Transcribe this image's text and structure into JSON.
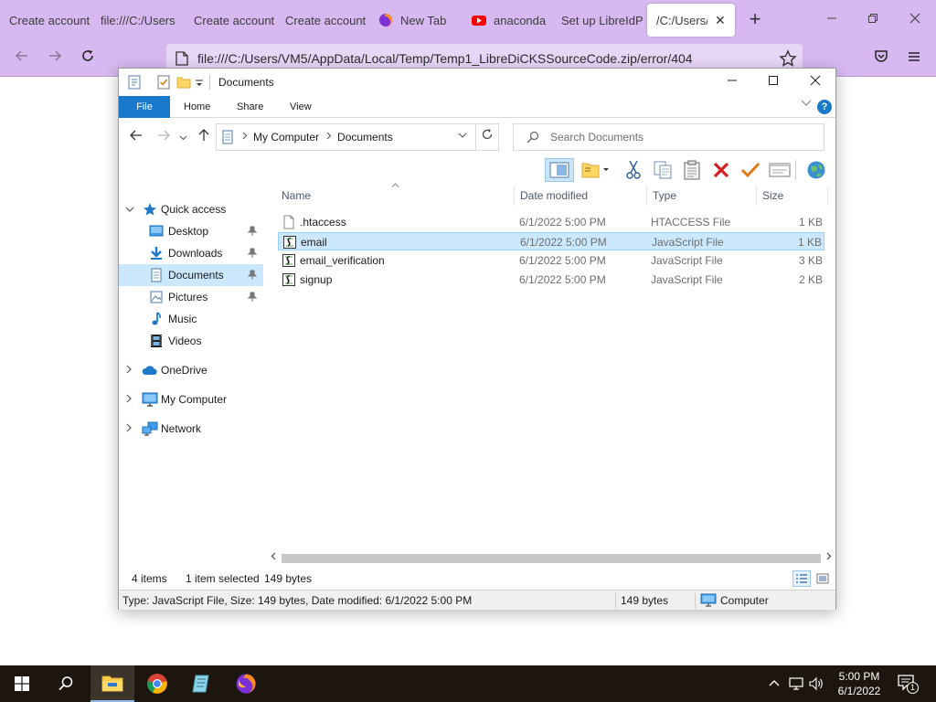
{
  "browser": {
    "tabs": [
      {
        "label": "Create account",
        "icon": "none"
      },
      {
        "label": "file:///C:/Users",
        "icon": "none"
      },
      {
        "label": "Create account",
        "icon": "none"
      },
      {
        "label": "Create account",
        "icon": "none"
      },
      {
        "label": "New Tab",
        "icon": "firefox-icon"
      },
      {
        "label": "anaconda",
        "icon": "youtube-icon"
      },
      {
        "label": "Set up LibreIdP",
        "icon": "none"
      },
      {
        "label": "/C:/Users/V",
        "icon": "none",
        "active": true
      }
    ],
    "tab_close": "✕",
    "new_tab": "+",
    "url": "file:///C:/Users/VM5/AppData/Local/Temp/Temp1_LibreDiCKSSourceCode.zip/error/404",
    "accent_color": "#d7b8f0"
  },
  "explorer": {
    "title": "Documents",
    "ribbon_tabs": [
      "File",
      "Home",
      "Share",
      "View"
    ],
    "help": "?",
    "address": {
      "crumbs": [
        "My Computer",
        "Documents"
      ]
    },
    "search_placeholder": "Search Documents",
    "nav": {
      "quick_access": "Quick access",
      "items": [
        {
          "label": "Desktop",
          "icon": "desktop-icon",
          "pinned": true
        },
        {
          "label": "Downloads",
          "icon": "download-icon",
          "pinned": true
        },
        {
          "label": "Documents",
          "icon": "document-icon",
          "pinned": true,
          "selected": true
        },
        {
          "label": "Pictures",
          "icon": "pictures-icon",
          "pinned": true
        },
        {
          "label": "Music",
          "icon": "music-icon",
          "pinned": false
        },
        {
          "label": "Videos",
          "icon": "videos-icon",
          "pinned": false
        }
      ],
      "onedrive": "OneDrive",
      "my_computer": "My Computer",
      "network": "Network"
    },
    "columns": {
      "name": "Name",
      "date": "Date modified",
      "type": "Type",
      "size": "Size"
    },
    "files": [
      {
        "name": ".htaccess",
        "date": "6/1/2022 5:00 PM",
        "type": "HTACCESS File",
        "size": "1 KB",
        "icon": "blank-file-icon"
      },
      {
        "name": "email",
        "date": "6/1/2022 5:00 PM",
        "type": "JavaScript File",
        "size": "1 KB",
        "icon": "script-file-icon",
        "selected": true
      },
      {
        "name": "email_verification",
        "date": "6/1/2022 5:00 PM",
        "type": "JavaScript File",
        "size": "3 KB",
        "icon": "script-file-icon"
      },
      {
        "name": "signup",
        "date": "6/1/2022 5:00 PM",
        "type": "JavaScript File",
        "size": "2 KB",
        "icon": "script-file-icon"
      }
    ],
    "status": {
      "items": "4 items",
      "selected": "1 item selected",
      "bytes": "149 bytes"
    },
    "details_bar": {
      "info": "Type: JavaScript File, Size: 149 bytes, Date modified: 6/1/2022 5:00 PM",
      "size": "149 bytes",
      "location": "Computer"
    },
    "accent_color": "#1979ca",
    "selection_color": "#cce8ff"
  },
  "taskbar": {
    "time": "5:00 PM",
    "date": "6/1/2022",
    "notification_count": "1"
  }
}
